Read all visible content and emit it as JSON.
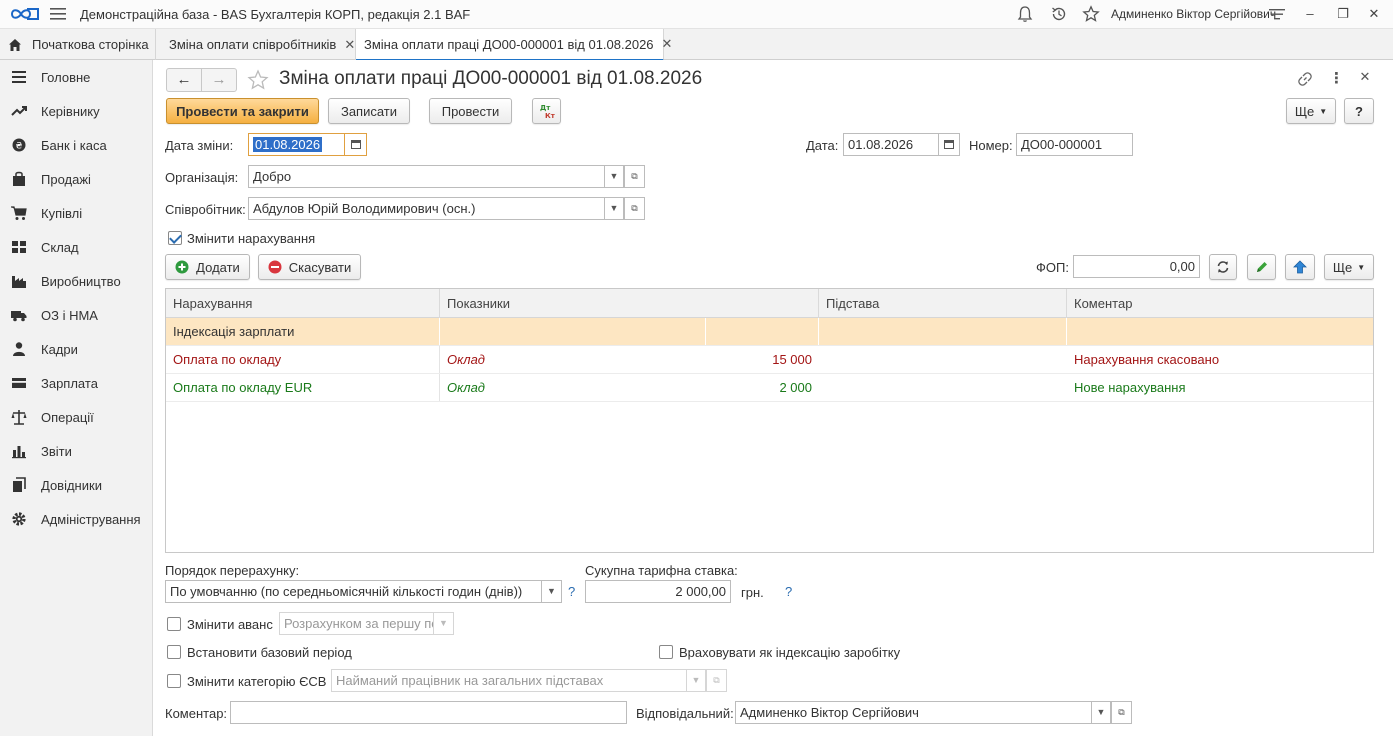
{
  "window": {
    "title": "Демонстраційна база - BAS Бухгалтерія КОРП, редакція 2.1 BAF",
    "user": "Админенко Віктор Сергійович"
  },
  "tabs": [
    {
      "label": "Початкова сторінка"
    },
    {
      "label": "Зміна оплати співробітників"
    },
    {
      "label": "Зміна оплати праці ДО00-000001 від 01.08.2026"
    }
  ],
  "sidebar": {
    "items": [
      {
        "label": "Головне",
        "icon": "menu-lines-icon"
      },
      {
        "label": "Керівнику",
        "icon": "trend-icon"
      },
      {
        "label": "Банк і каса",
        "icon": "coin-icon"
      },
      {
        "label": "Продажі",
        "icon": "bag-icon"
      },
      {
        "label": "Купівлі",
        "icon": "cart-icon"
      },
      {
        "label": "Склад",
        "icon": "grid-icon"
      },
      {
        "label": "Виробництво",
        "icon": "factory-icon"
      },
      {
        "label": "ОЗ і НМА",
        "icon": "truck-icon"
      },
      {
        "label": "Кадри",
        "icon": "person-icon"
      },
      {
        "label": "Зарплата",
        "icon": "card-icon"
      },
      {
        "label": "Операції",
        "icon": "scales-icon"
      },
      {
        "label": "Звіти",
        "icon": "bar-chart-icon"
      },
      {
        "label": "Довідники",
        "icon": "books-icon"
      },
      {
        "label": "Адміністрування",
        "icon": "gear-icon"
      }
    ]
  },
  "form": {
    "title": "Зміна оплати праці ДО00-000001 від 01.08.2026",
    "toolbar": {
      "post_close": "Провести та закрити",
      "save": "Записати",
      "post": "Провести",
      "more": "Ще",
      "help": "?"
    },
    "change_date": {
      "label": "Дата зміни:",
      "value": "01.08.2026"
    },
    "date": {
      "label": "Дата:",
      "value": "01.08.2026"
    },
    "number": {
      "label": "Номер:",
      "value": "ДО00-000001"
    },
    "organization": {
      "label": "Організація:",
      "value": "Добро"
    },
    "employee": {
      "label": "Співробітник:",
      "value": "Абдулов Юрій Володимирович (осн.)"
    },
    "change_accruals": {
      "label": "Змінити нарахування",
      "checked": true
    },
    "accrual_toolbar": {
      "add": "Додати",
      "cancel": "Скасувати",
      "fop_label": "ФОП:",
      "fop_value": "0,00",
      "more": "Ще"
    },
    "table": {
      "headers": [
        "Нарахування",
        "Показники",
        "Підстава",
        "Коментар"
      ],
      "rows": [
        {
          "accrual": "Індексація зарплати",
          "indicator": "",
          "value": "",
          "basis": "",
          "comment": "",
          "style": "group"
        },
        {
          "accrual": "Оплата по окладу",
          "indicator": "Оклад",
          "value": "15 000",
          "basis": "",
          "comment": "Нарахування скасовано",
          "style": "cancelled"
        },
        {
          "accrual": "Оплата по окладу EUR",
          "indicator": "Оклад",
          "value": "2 000",
          "basis": "",
          "comment": "Нове нарахування",
          "style": "new"
        }
      ]
    },
    "recalc": {
      "label": "Порядок перерахунку:",
      "value": "По умовчанню (по середньомісячній кількості годин (днів))",
      "help": "?"
    },
    "tariff": {
      "label": "Сукупна тарифна ставка:",
      "value": "2 000,00",
      "unit": "грн.",
      "help": "?"
    },
    "change_advance": {
      "label": "Змінити аванс",
      "value": "Розрахунком за першу пол",
      "checked": false
    },
    "base_period": {
      "label": "Встановити базовий період",
      "checked": false
    },
    "indexation": {
      "label": "Враховувати як індексацію заробітку",
      "checked": false
    },
    "esv": {
      "label": "Змінити категорію ЄСВ",
      "value": "Найманий працівник на загальних підставах",
      "checked": false
    },
    "comment": {
      "label": "Коментар:",
      "value": ""
    },
    "responsible": {
      "label": "Відповідальний:",
      "value": "Админенко Віктор Сергійович"
    }
  },
  "colors": {
    "accent": "#1e73c7",
    "primary_button": "#f5b041",
    "group_row": "#fde6c2",
    "cancelled": "#a31515",
    "new": "#1a7a1a"
  }
}
